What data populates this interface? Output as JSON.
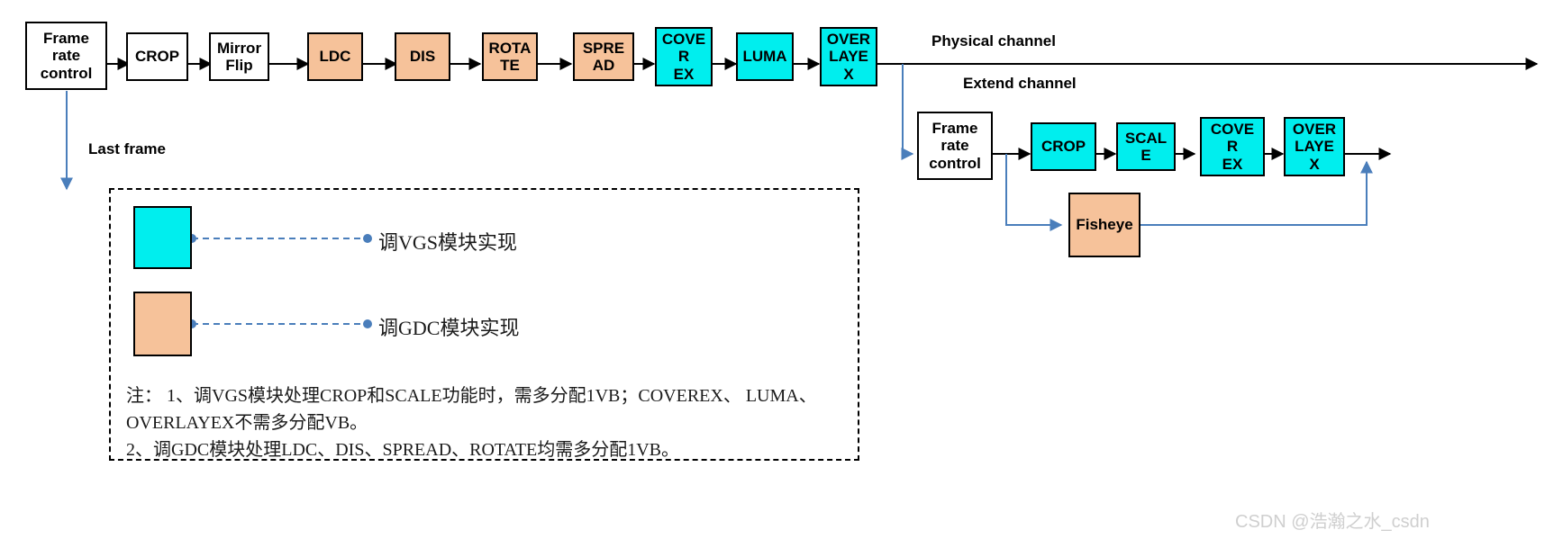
{
  "diagram": {
    "colors": {
      "vgs_block": "#00EEEE",
      "gdc_block": "#F6C29A",
      "plain_block": "#FFFFFF",
      "black_arrow": "#000000",
      "blue_arrow": "#4A7EBB",
      "watermark": "#CFCFCF"
    },
    "physical_channel": {
      "label": "Physical channel",
      "blocks": [
        {
          "id": "frc1",
          "text": "Frame\nrate\ncontrol",
          "kind": "plain"
        },
        {
          "id": "crop1",
          "text": "CROP",
          "kind": "plain"
        },
        {
          "id": "mirrorflip",
          "text": "Mirror\nFlip",
          "kind": "plain"
        },
        {
          "id": "ldc",
          "text": "LDC",
          "kind": "gdc"
        },
        {
          "id": "dis",
          "text": "DIS",
          "kind": "gdc"
        },
        {
          "id": "rotate",
          "text": "ROTA\nTE",
          "kind": "gdc"
        },
        {
          "id": "spread",
          "text": "SPRE\nAD",
          "kind": "gdc"
        },
        {
          "id": "coverex1",
          "text": "COVE\nR\nEX",
          "kind": "vgs"
        },
        {
          "id": "luma",
          "text": "LUMA",
          "kind": "vgs"
        },
        {
          "id": "overlayex1",
          "text": "OVER\nLAYE\nX",
          "kind": "vgs"
        }
      ]
    },
    "extend_channel": {
      "label": "Extend channel",
      "blocks": [
        {
          "id": "frc2",
          "text": "Frame\nrate\ncontrol",
          "kind": "plain"
        },
        {
          "id": "crop2",
          "text": "CROP",
          "kind": "vgs"
        },
        {
          "id": "scale",
          "text": "SCAL\nE",
          "kind": "vgs"
        },
        {
          "id": "coverex2",
          "text": "COVE\nR\nEX",
          "kind": "vgs"
        },
        {
          "id": "overlayex2",
          "text": "OVER\nLAYE\nX",
          "kind": "vgs"
        },
        {
          "id": "fisheye",
          "text": "Fisheye",
          "kind": "gdc"
        }
      ]
    },
    "last_frame_label": "Last frame",
    "legend": {
      "items": [
        {
          "swatch": "vgs",
          "text": "调VGS模块实现"
        },
        {
          "swatch": "gdc",
          "text": "调GDC模块实现"
        }
      ],
      "notes": "注： 1、调VGS模块处理CROP和SCALE功能时，需多分配1VB；COVEREX、 LUMA、 OVERLAYEX不需多分配VB。\n        2、调GDC模块处理LDC、DIS、SPREAD、ROTATE均需多分配1VB。"
    },
    "watermark": "CSDN @浩瀚之水_csdn"
  }
}
